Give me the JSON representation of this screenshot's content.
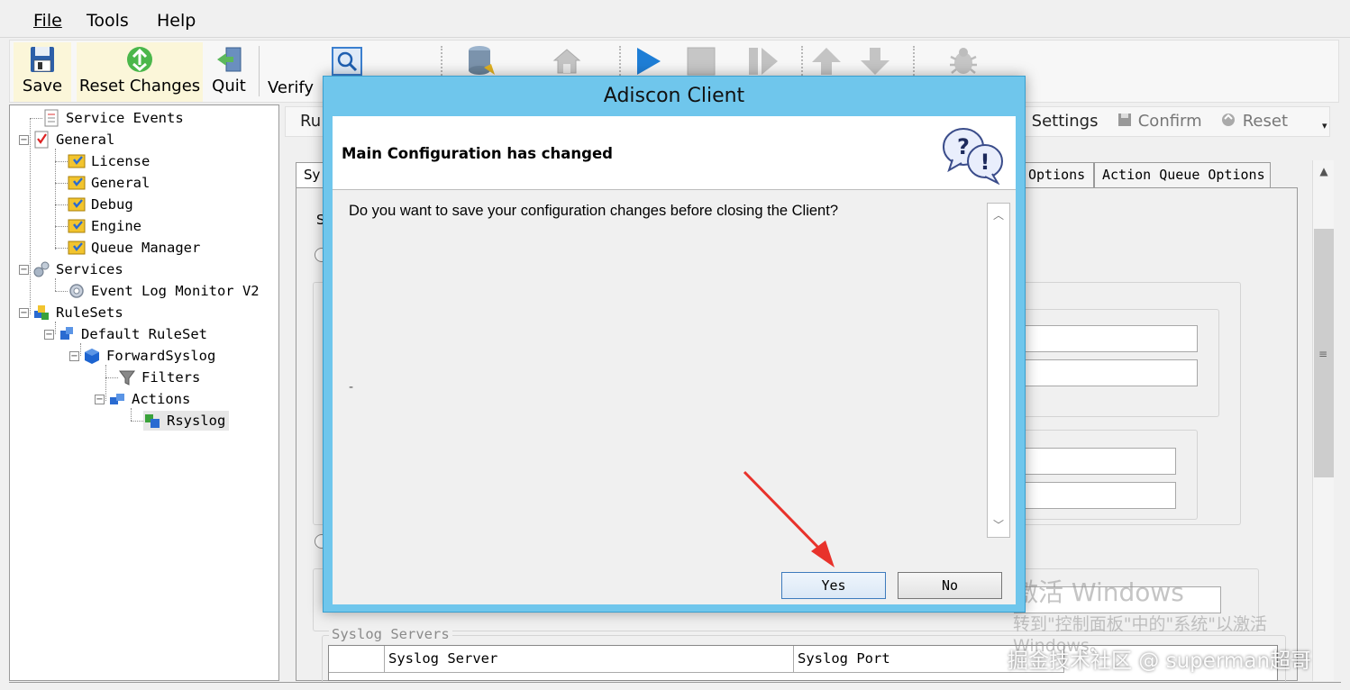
{
  "menu": {
    "file": "File",
    "tools": "Tools",
    "help": "Help"
  },
  "toolbar": {
    "save": "Save",
    "reset_changes": "Reset Changes",
    "quit": "Quit",
    "verify": "Verify"
  },
  "tree": {
    "items": [
      {
        "label": "Service Events",
        "icon": "service-events-icon"
      },
      {
        "label": "General",
        "icon": "checklist-icon"
      },
      {
        "label": "License",
        "icon": "config-shield-icon"
      },
      {
        "label": "General",
        "icon": "config-shield-icon"
      },
      {
        "label": "Debug",
        "icon": "config-shield-icon"
      },
      {
        "label": "Engine",
        "icon": "config-shield-icon"
      },
      {
        "label": "Queue Manager",
        "icon": "config-shield-icon"
      },
      {
        "label": "Services",
        "icon": "gears-icon"
      },
      {
        "label": "Event Log Monitor V2",
        "icon": "gear-icon"
      },
      {
        "label": "RuleSets",
        "icon": "rulesets-icon"
      },
      {
        "label": "Default RuleSet",
        "icon": "ruleset-icon"
      },
      {
        "label": "ForwardSyslog",
        "icon": "rule-cube-icon"
      },
      {
        "label": "Filters",
        "icon": "filter-funnel-icon"
      },
      {
        "label": "Actions",
        "icon": "actions-icon"
      },
      {
        "label": "Rsyslog",
        "icon": "rsyslog-action-icon"
      }
    ]
  },
  "right": {
    "subtoolbar_left": "Ru",
    "settings": "Settings",
    "confirm": "Confirm",
    "reset": "Reset",
    "tab_left": "Sy",
    "tab_options": "Options",
    "tab_action_queue": "Action Queue Options",
    "group_left_letter": "S",
    "syslog_servers_legend": "Syslog Servers",
    "grid_col_server": "Syslog Server",
    "grid_col_port": "Syslog Port"
  },
  "dialog": {
    "title": "Adiscon Client",
    "header": "Main Configuration has changed",
    "message": "Do you want to save your configuration changes before closing the Client?",
    "dash": "-",
    "yes": "Yes",
    "no": "No"
  },
  "watermarks": {
    "activate_title": "激活 Windows",
    "activate_sub": "转到\"控制面板\"中的\"系统\"以激活",
    "activate_sub2": "Windows。",
    "credit": "掘金技术社区 @ superman超哥"
  },
  "colors": {
    "dialog_frame": "#6fc6ec",
    "arrow": "#e8322b"
  }
}
